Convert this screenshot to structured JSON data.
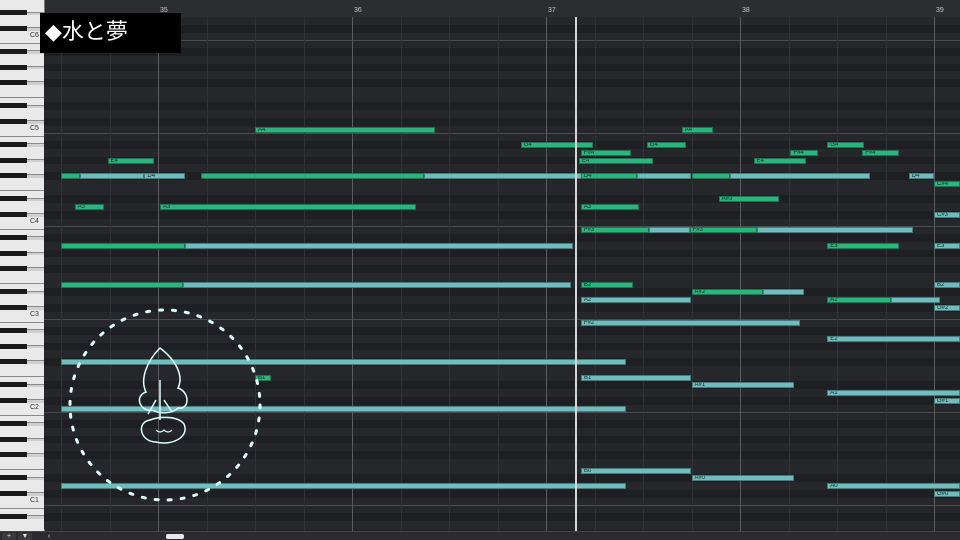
{
  "title": "◆水と夢",
  "ruler": {
    "bars": [
      "35",
      "36",
      "37",
      "38",
      "39"
    ]
  },
  "piano": {
    "octave_labels": [
      "C6",
      "C5",
      "C4",
      "C3",
      "C2",
      "C1"
    ]
  },
  "notes": [
    {
      "label": "A4",
      "color": "green",
      "bar": 35.5,
      "len": 0.93,
      "row": 51
    },
    {
      "label": "G4",
      "color": "green",
      "bar": 36.87,
      "len": 0.37,
      "row": 49
    },
    {
      "label": "F#4",
      "color": "green",
      "bar": 37.18,
      "len": 0.26,
      "row": 48
    },
    {
      "label": "G4",
      "color": "green",
      "bar": 37.52,
      "len": 0.2,
      "row": 49
    },
    {
      "label": "A4",
      "color": "green",
      "bar": 37.7,
      "len": 0.16,
      "row": 51
    },
    {
      "label": "E4",
      "color": "green",
      "bar": 37.17,
      "len": 0.38,
      "row": 47
    },
    {
      "label": "F#4",
      "color": "green",
      "bar": 38.26,
      "len": 0.14,
      "row": 48
    },
    {
      "label": "G4",
      "color": "green",
      "bar": 38.45,
      "len": 0.19,
      "row": 49
    },
    {
      "label": "F#4",
      "color": "green",
      "bar": 38.63,
      "len": 0.19,
      "row": 48
    },
    {
      "label": "E4",
      "color": "green",
      "bar": 38.07,
      "len": 0.27,
      "row": 47
    },
    {
      "label": "E4",
      "color": "green",
      "bar": 34.74,
      "len": 0.24,
      "row": 47
    },
    {
      "label": "",
      "color": "green",
      "bar": 34.5,
      "len": 0.1,
      "row": 45
    },
    {
      "label": "",
      "color": "teal",
      "bar": 34.6,
      "len": 0.33,
      "row": 45
    },
    {
      "label": "D4",
      "color": "teal",
      "bar": 34.93,
      "len": 0.21,
      "row": 45
    },
    {
      "label": "D4",
      "color": "teal",
      "bar": 35.22,
      "len": 1.15,
      "row": 45
    },
    {
      "label": "",
      "color": "green",
      "bar": 35.22,
      "len": 1.15,
      "row": 45
    },
    {
      "label": "",
      "color": "teal",
      "bar": 36.37,
      "len": 0.94,
      "row": 45
    },
    {
      "label": "D4",
      "color": "green",
      "bar": 37.18,
      "len": 0.29,
      "row": 45
    },
    {
      "label": "",
      "color": "teal",
      "bar": 37.47,
      "len": 0.28,
      "row": 45
    },
    {
      "label": "D4",
      "color": "teal",
      "bar": 37.75,
      "len": 0.2,
      "row": 45
    },
    {
      "label": "",
      "color": "green",
      "bar": 37.75,
      "len": 0.2,
      "row": 45
    },
    {
      "label": "",
      "color": "teal",
      "bar": 37.95,
      "len": 0.72,
      "row": 45
    },
    {
      "label": "D4",
      "color": "teal",
      "bar": 38.87,
      "len": 0.13,
      "row": 45
    },
    {
      "label": "C#4",
      "color": "green",
      "bar": 39.0,
      "len": 0.2,
      "row": 44
    },
    {
      "label": "A3",
      "color": "green",
      "bar": 34.57,
      "len": 0.15,
      "row": 41
    },
    {
      "label": "A3",
      "color": "green",
      "bar": 35.01,
      "len": 1.32,
      "row": 41
    },
    {
      "label": "A3",
      "color": "green",
      "bar": 37.18,
      "len": 0.3,
      "row": 41
    },
    {
      "label": "A#3",
      "color": "green",
      "bar": 37.89,
      "len": 0.31,
      "row": 42
    },
    {
      "label": "C#3",
      "color": "teal",
      "bar": 39.0,
      "len": 0.2,
      "row": 40
    },
    {
      "label": "F#3",
      "color": "green",
      "bar": 37.18,
      "len": 0.35,
      "row": 38
    },
    {
      "label": "",
      "color": "teal",
      "bar": 37.53,
      "len": 0.21,
      "row": 38
    },
    {
      "label": "F#3",
      "color": "green",
      "bar": 37.74,
      "len": 0.35,
      "row": 38
    },
    {
      "label": "",
      "color": "teal",
      "bar": 38.09,
      "len": 0.8,
      "row": 38
    },
    {
      "label": "",
      "color": "green",
      "bar": 34.5,
      "len": 0.64,
      "row": 36
    },
    {
      "label": "",
      "color": "teal",
      "bar": 35.14,
      "len": 2.0,
      "row": 36
    },
    {
      "label": "E3",
      "color": "green",
      "bar": 38.45,
      "len": 0.37,
      "row": 36
    },
    {
      "label": "E3",
      "color": "teal",
      "bar": 39.0,
      "len": 0.2,
      "row": 36
    },
    {
      "label": "",
      "color": "green",
      "bar": 34.5,
      "len": 0.63,
      "row": 31
    },
    {
      "label": "",
      "color": "teal",
      "bar": 35.13,
      "len": 2.0,
      "row": 31
    },
    {
      "label": "B2",
      "color": "green",
      "bar": 37.18,
      "len": 0.27,
      "row": 31
    },
    {
      "label": "B2",
      "color": "teal",
      "bar": 39.0,
      "len": 0.2,
      "row": 31
    },
    {
      "label": "A2",
      "color": "teal",
      "bar": 37.18,
      "len": 0.57,
      "row": 29
    },
    {
      "label": "A#2",
      "color": "green",
      "bar": 37.75,
      "len": 0.37,
      "row": 30
    },
    {
      "label": "",
      "color": "teal",
      "bar": 38.12,
      "len": 0.21,
      "row": 30
    },
    {
      "label": "A2",
      "color": "green",
      "bar": 38.45,
      "len": 0.33,
      "row": 29
    },
    {
      "label": "",
      "color": "teal",
      "bar": 38.78,
      "len": 0.25,
      "row": 29
    },
    {
      "label": "G#2",
      "color": "teal",
      "bar": 39.0,
      "len": 0.2,
      "row": 28
    },
    {
      "label": "F#2",
      "color": "teal",
      "bar": 37.18,
      "len": 1.13,
      "row": 26
    },
    {
      "label": "E2",
      "color": "teal",
      "bar": 38.45,
      "len": 0.75,
      "row": 24
    },
    {
      "label": "",
      "color": "teal",
      "bar": 34.5,
      "len": 2.91,
      "row": 21
    },
    {
      "label": "B1",
      "color": "teal",
      "bar": 37.18,
      "len": 0.57,
      "row": 19
    },
    {
      "label": "A#1",
      "color": "teal",
      "bar": 37.75,
      "len": 0.53,
      "row": 18
    },
    {
      "label": "A1",
      "color": "teal",
      "bar": 38.45,
      "len": 0.75,
      "row": 17
    },
    {
      "label": "G#1",
      "color": "teal",
      "bar": 39.0,
      "len": 0.2,
      "row": 16
    },
    {
      "label": "B1",
      "color": "green",
      "bar": 35.5,
      "len": 0.08,
      "row": 19
    },
    {
      "label": "",
      "color": "teal",
      "bar": 34.5,
      "len": 2.91,
      "row": 15
    },
    {
      "label": "B0",
      "color": "teal",
      "bar": 37.18,
      "len": 0.57,
      "row": 7
    },
    {
      "label": "A#0",
      "color": "teal",
      "bar": 37.75,
      "len": 0.53,
      "row": 6
    },
    {
      "label": "A0",
      "color": "teal",
      "bar": 38.45,
      "len": 0.75,
      "row": 5
    },
    {
      "label": "G#0",
      "color": "teal",
      "bar": 39.0,
      "len": 0.2,
      "row": 4
    },
    {
      "label": "",
      "color": "teal",
      "bar": 34.5,
      "len": 2.91,
      "row": 5
    }
  ],
  "colors": {
    "green": "#2bb57e",
    "teal": "#6fbdbd"
  },
  "bottom": {
    "add_label": "+",
    "menu_label": "▼",
    "scroll_left": "‹"
  }
}
